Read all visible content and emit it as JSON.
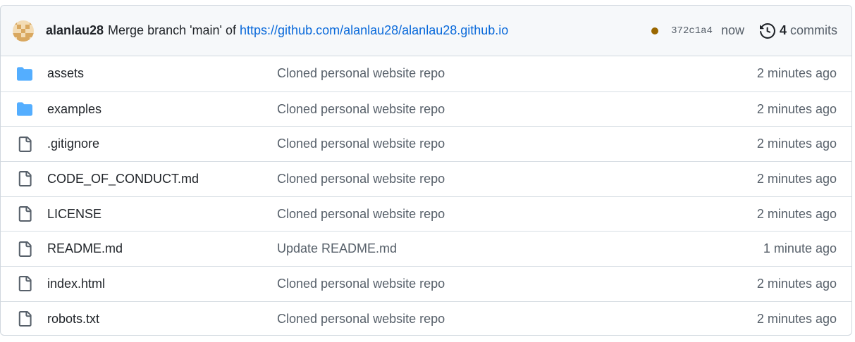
{
  "commit": {
    "author": "alanlau28",
    "message_prefix": "Merge branch 'main' of ",
    "message_link": "https://github.com/alanlau28/alanlau28.github.io",
    "status_color": "#9a6700",
    "sha": "372c1a4",
    "time": "now",
    "commit_count": "4",
    "commit_label": "commits",
    "avatar_colors": {
      "light": "#f3dcb5",
      "dark": "#d9a860"
    }
  },
  "colors": {
    "folder": "#54aeff",
    "file": "#57606a",
    "link": "#0969da"
  },
  "files": [
    {
      "name": "assets",
      "type": "folder",
      "message": "Cloned personal website repo",
      "time": "2 minutes ago"
    },
    {
      "name": "examples",
      "type": "folder",
      "message": "Cloned personal website repo",
      "time": "2 minutes ago"
    },
    {
      "name": ".gitignore",
      "type": "file",
      "message": "Cloned personal website repo",
      "time": "2 minutes ago"
    },
    {
      "name": "CODE_OF_CONDUCT.md",
      "type": "file",
      "message": "Cloned personal website repo",
      "time": "2 minutes ago"
    },
    {
      "name": "LICENSE",
      "type": "file",
      "message": "Cloned personal website repo",
      "time": "2 minutes ago"
    },
    {
      "name": "README.md",
      "type": "file",
      "message": "Update README.md",
      "time": "1 minute ago"
    },
    {
      "name": "index.html",
      "type": "file",
      "message": "Cloned personal website repo",
      "time": "2 minutes ago"
    },
    {
      "name": "robots.txt",
      "type": "file",
      "message": "Cloned personal website repo",
      "time": "2 minutes ago"
    }
  ]
}
